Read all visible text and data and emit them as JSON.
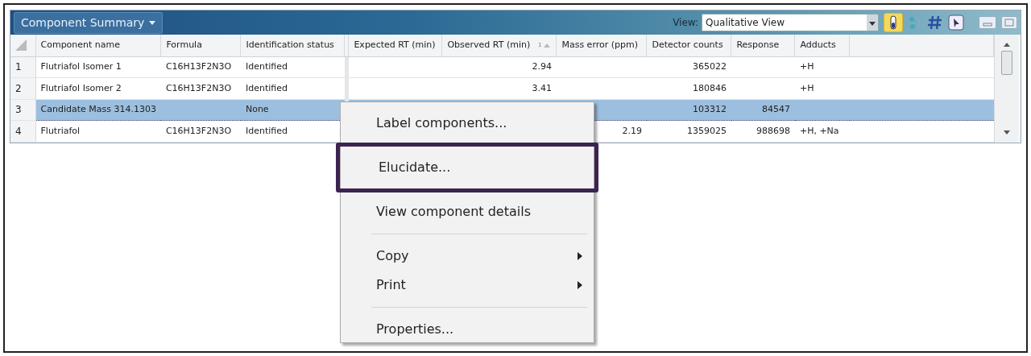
{
  "panel": {
    "title": "Component Summary",
    "view_label": "View:",
    "view_value": "Qualitative View"
  },
  "table": {
    "columns": [
      {
        "label": "Component name",
        "kind": "text"
      },
      {
        "label": "Formula",
        "kind": "text"
      },
      {
        "label": "Identification status",
        "kind": "text"
      },
      {
        "label": "Expected RT (min)",
        "kind": "number"
      },
      {
        "label": "Observed RT (min)",
        "kind": "number",
        "sort_index": "1",
        "sorted": true
      },
      {
        "label": "Mass error (ppm)",
        "kind": "number"
      },
      {
        "label": "Detector counts",
        "kind": "number"
      },
      {
        "label": "Response",
        "kind": "number"
      },
      {
        "label": "Adducts",
        "kind": "text"
      }
    ],
    "rows": [
      {
        "number": "1",
        "selected": false,
        "cells": [
          "Flutriafol Isomer 1",
          "C16H13F2N3O",
          "Identified",
          null,
          "2.94",
          null,
          "365022",
          null,
          "+H"
        ]
      },
      {
        "number": "2",
        "selected": false,
        "cells": [
          "Flutriafol Isomer 2",
          "C16H13F2N3O",
          "Identified",
          null,
          "3.41",
          null,
          "180846",
          null,
          "+H"
        ]
      },
      {
        "number": "3",
        "selected": true,
        "cells": [
          "Candidate Mass 314.1303",
          null,
          "None",
          null,
          null,
          null,
          "103312",
          "84547",
          null
        ]
      },
      {
        "number": "4",
        "selected": false,
        "cells": [
          "Flutriafol",
          "C16H13F2N3O",
          "Identified",
          null,
          null,
          "2.19",
          "1359025",
          "988698",
          "+H, +Na"
        ]
      }
    ]
  },
  "context_menu": [
    {
      "kind": "item",
      "label": "Label components...",
      "submenu": false,
      "highlighted": false
    },
    {
      "kind": "item",
      "label": "Elucidate...",
      "submenu": false,
      "highlighted": true
    },
    {
      "kind": "item",
      "label": "View component details",
      "submenu": false,
      "highlighted": false
    },
    {
      "kind": "separator"
    },
    {
      "kind": "item",
      "label": "Copy",
      "submenu": true,
      "highlighted": false
    },
    {
      "kind": "item",
      "label": "Print",
      "submenu": true,
      "highlighted": false
    },
    {
      "kind": "separator"
    },
    {
      "kind": "item",
      "label": "Properties...",
      "submenu": false,
      "highlighted": false
    }
  ]
}
